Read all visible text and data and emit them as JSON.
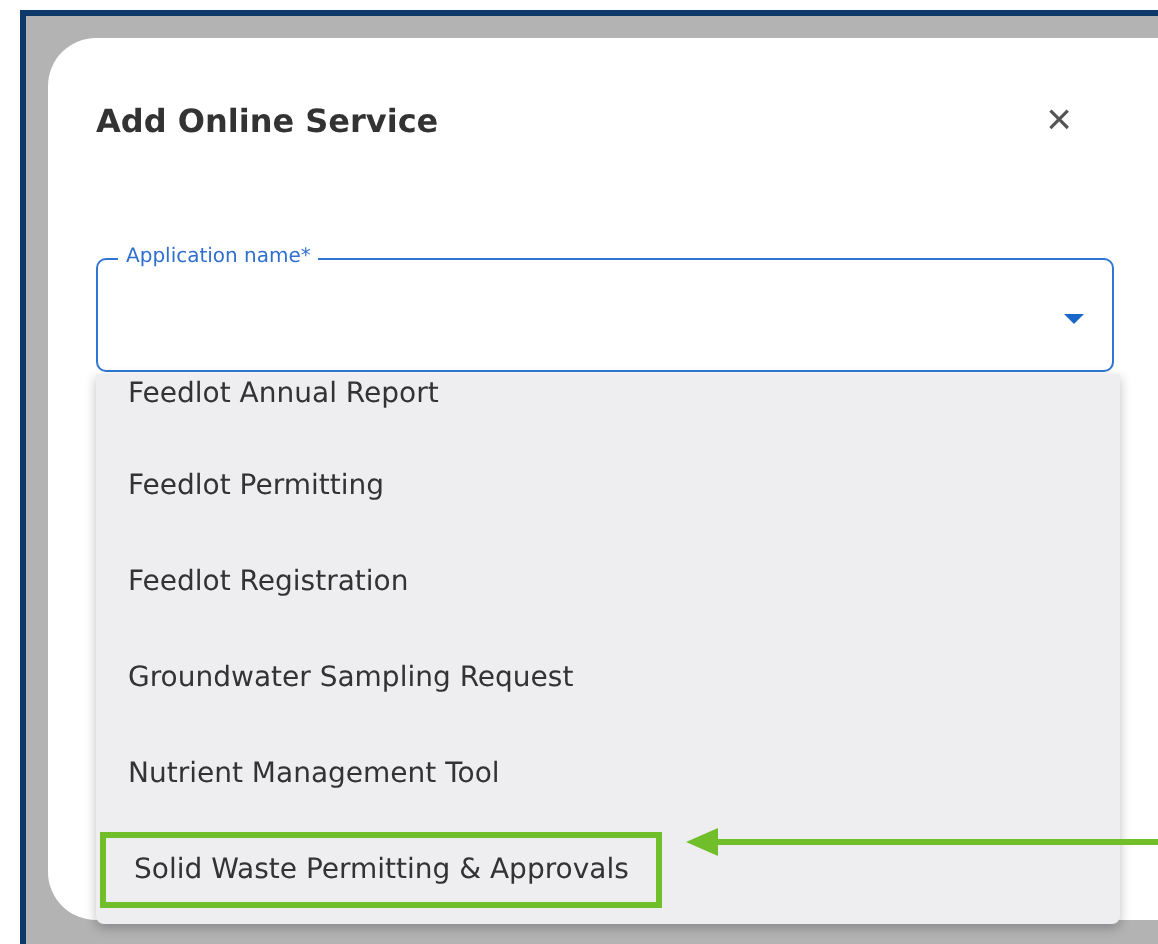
{
  "dialog": {
    "title": "Add Online Service",
    "close": "×",
    "field": {
      "label": "Application name*"
    },
    "options": [
      {
        "label": "Feedlot Annual Report",
        "highlighted": false
      },
      {
        "label": "Feedlot Permitting",
        "highlighted": false
      },
      {
        "label": "Feedlot Registration",
        "highlighted": false
      },
      {
        "label": "Groundwater Sampling Request",
        "highlighted": false
      },
      {
        "label": "Nutrient Management Tool",
        "highlighted": false
      },
      {
        "label": "Solid Waste Permitting & Approvals",
        "highlighted": true
      }
    ]
  }
}
